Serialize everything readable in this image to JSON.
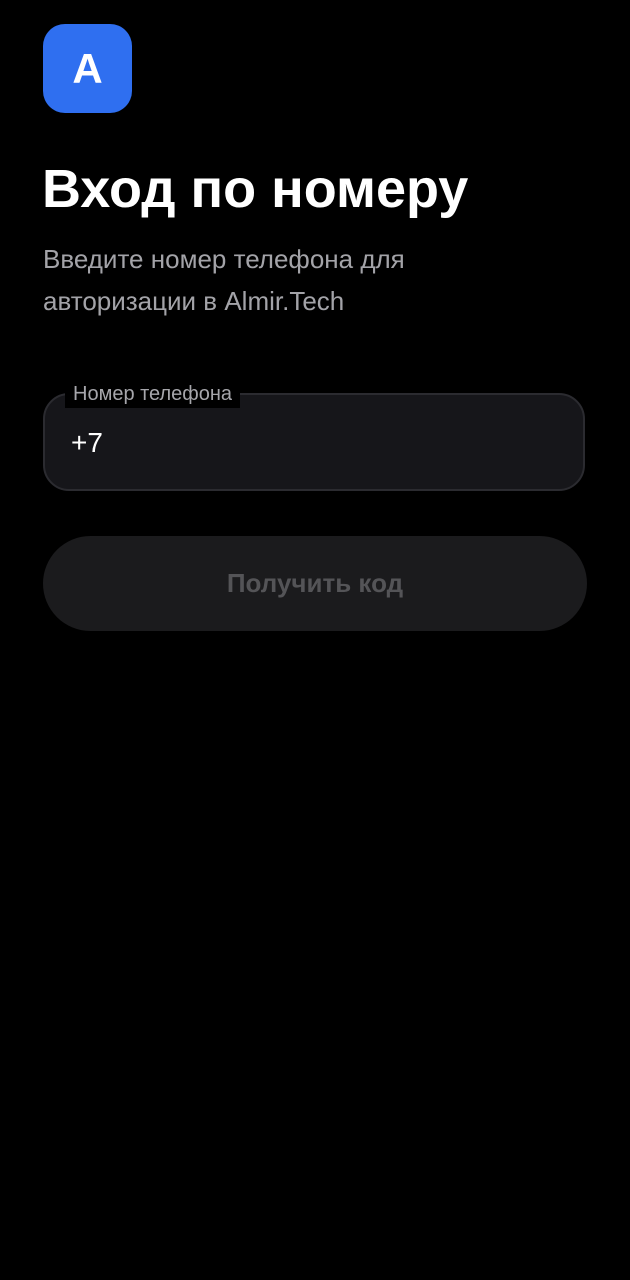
{
  "logo": {
    "letter": "A",
    "color": "#2f6ff0"
  },
  "header": {
    "title": "Вход по номеру",
    "subtitle": "Введите номер телефона для авторизации в Almir.Tech"
  },
  "phone_field": {
    "label": "Номер телефона",
    "value": "+7"
  },
  "submit_button": {
    "label": "Получить код",
    "state": "disabled"
  },
  "colors": {
    "background": "#000000",
    "accent": "#2f6ff0",
    "field_background": "#16161a",
    "button_background": "#1b1b1d",
    "button_text_disabled": "#545457",
    "subtitle_text": "#a3a3a8"
  }
}
